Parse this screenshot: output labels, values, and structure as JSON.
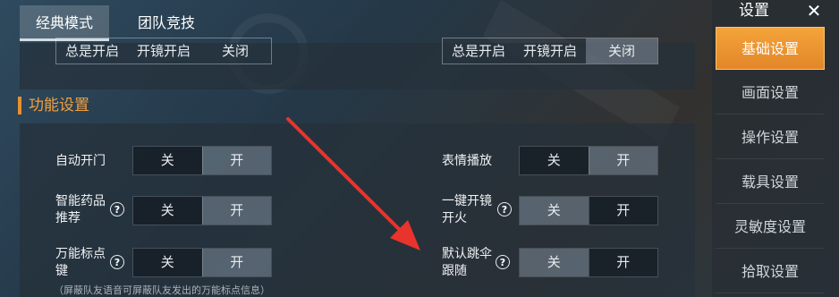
{
  "tabs": [
    {
      "label": "经典模式"
    },
    {
      "label": "团队竞技"
    }
  ],
  "top_row": {
    "left_options": [
      "总是开启",
      "开镜开启",
      "关闭"
    ],
    "right_options": [
      "总是开启",
      "开镜开启",
      "关闭"
    ]
  },
  "section": {
    "title": "功能设置"
  },
  "settings": [
    {
      "label": "自动开门",
      "off": "关",
      "on": "开",
      "selected": "on"
    },
    {
      "label_line1": "智能药品",
      "label_line2": "推荐",
      "off": "关",
      "on": "开",
      "selected": "on"
    },
    {
      "label_line1": "万能标点",
      "label_line2": "键",
      "off": "关",
      "on": "开",
      "selected": "on"
    },
    {
      "label": "表情播放",
      "off": "关",
      "on": "开",
      "selected": "on"
    },
    {
      "label_line1": "一键开镜",
      "label_line2": "开火",
      "off": "关",
      "on": "开",
      "selected": "off"
    },
    {
      "label_line1": "默认跳伞",
      "label_line2": "跟随",
      "off": "关",
      "on": "开",
      "selected": "off"
    }
  ],
  "help_glyph": "?",
  "footnote": "（屏蔽队友语音可屏蔽队友发出的万能标点信息）",
  "nav": {
    "title": "设置",
    "close_glyph": "✕",
    "items": [
      {
        "label": "基础设置",
        "active": true
      },
      {
        "label": "画面设置"
      },
      {
        "label": "操作设置"
      },
      {
        "label": "载具设置"
      },
      {
        "label": "灵敏度设置"
      },
      {
        "label": "拾取设置"
      }
    ]
  },
  "colors": {
    "accent": "#e98f2f",
    "arrow": "#e8342c",
    "panel": "#26303a"
  }
}
